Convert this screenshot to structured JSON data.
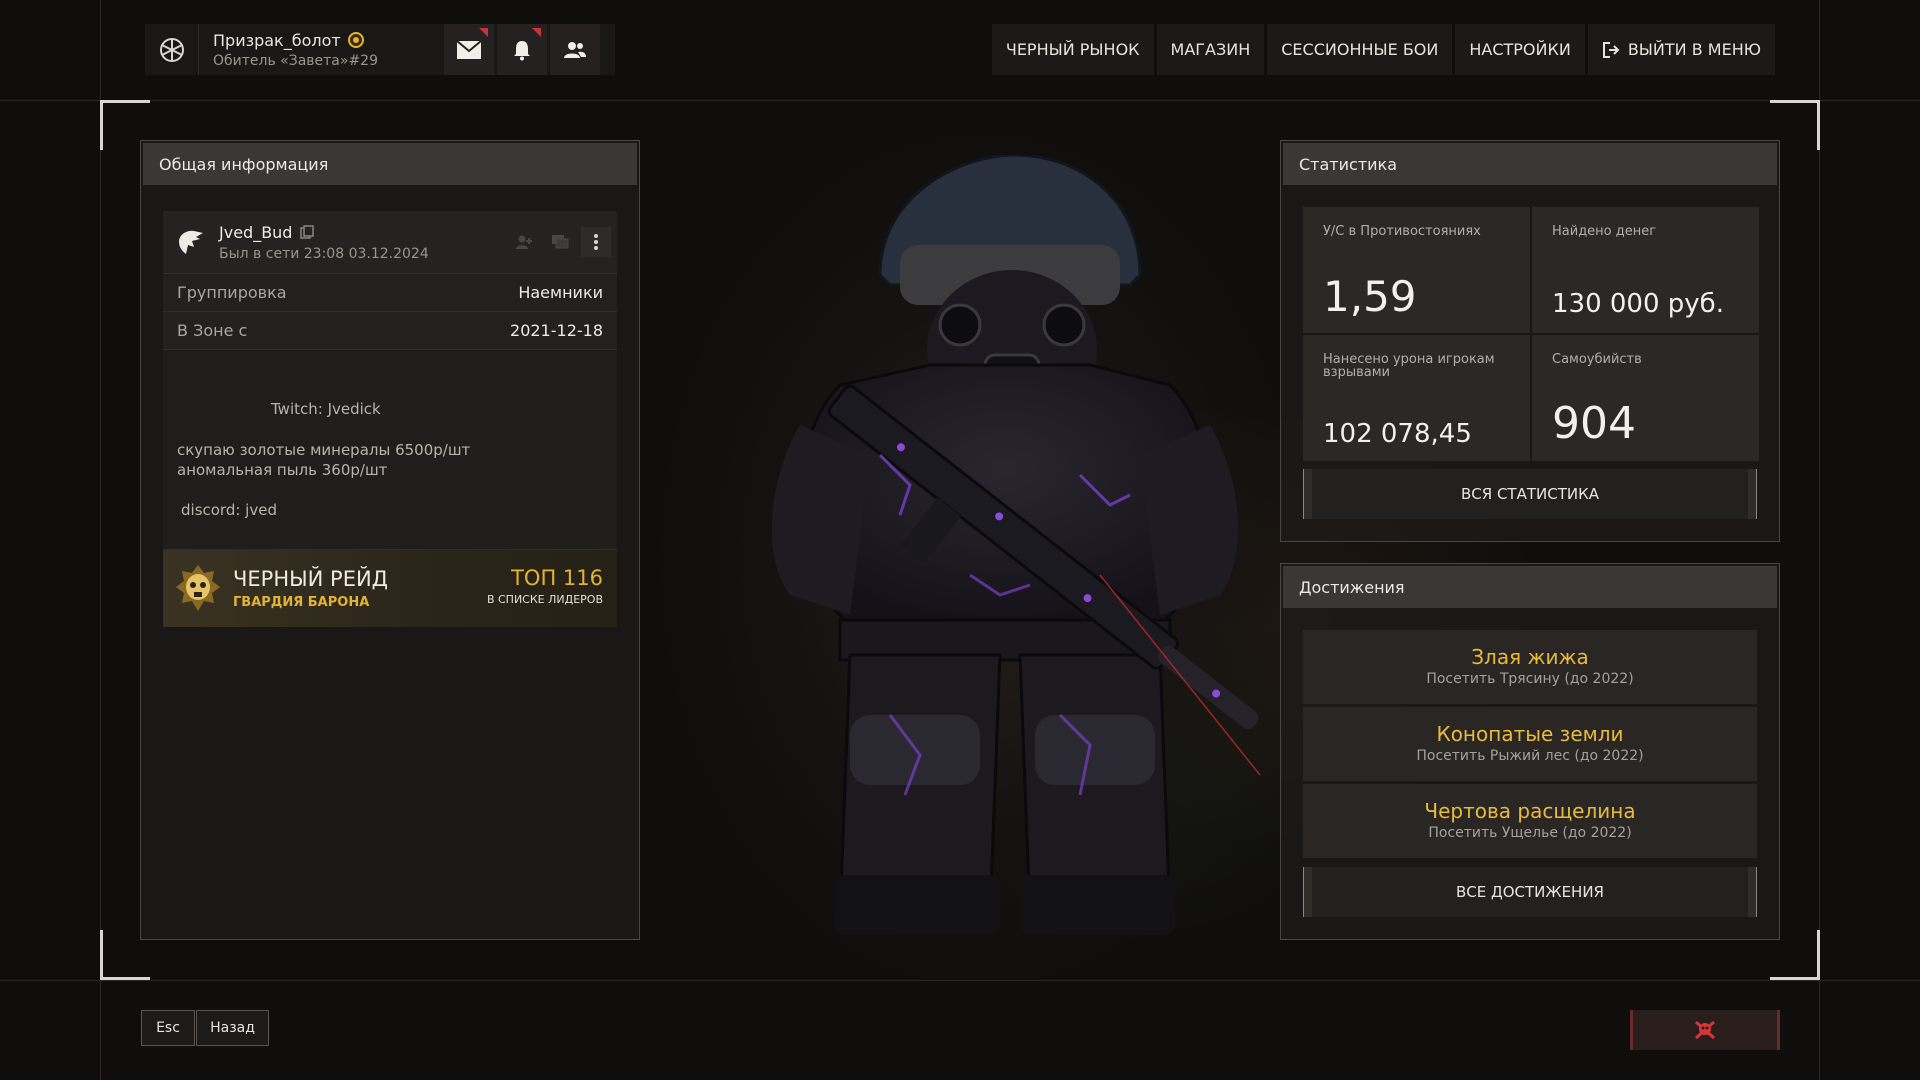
{
  "header": {
    "profile_name": "Призрак_болот",
    "profile_sub": "Обитель «Завета»#29",
    "nav": [
      "ЧЕРНЫЙ РЫНОК",
      "МАГАЗИН",
      "СЕССИОННЫЕ БОИ",
      "НАСТРОЙКИ",
      "ВЫЙТИ В МЕНЮ"
    ]
  },
  "general": {
    "title": "Общая информация",
    "username": "Jved_Bud",
    "last_seen": "Был в сети 23:08 03.12.2024",
    "rows": [
      {
        "key": "Группировка",
        "value": "Наемники"
      },
      {
        "key": "В Зоне с",
        "value": "2021-12-18"
      }
    ],
    "bio": {
      "twitch": "Twitch: Jvedick",
      "line1": "скупаю золотые минералы 6500р/шт",
      "line2": "аномальная пыль 360р/шт",
      "discord": "discord: jved"
    },
    "raid": {
      "title": "ЧЕРНЫЙ РЕЙД",
      "subtitle": "ГВАРДИЯ БАРОНА",
      "top": "ТОП 116",
      "top_sub": "В СПИСКЕ ЛИДЕРОВ"
    }
  },
  "stats": {
    "title": "Статистика",
    "cells": [
      {
        "label": "У/С в Противостояниях",
        "value": "1,59"
      },
      {
        "label": "Найдено денег",
        "value": "130 000 руб."
      },
      {
        "label": "Нанесено урона игрокам взрывами",
        "value": "102 078,45"
      },
      {
        "label": "Самоубийств",
        "value": "904"
      }
    ],
    "button": "ВСЯ СТАТИСТИКА"
  },
  "achievements": {
    "title": "Достижения",
    "items": [
      {
        "title": "Злая жижа",
        "desc": "Посетить Трясину (до 2022)"
      },
      {
        "title": "Конопатые земли",
        "desc": "Посетить Рыжий лес (до 2022)"
      },
      {
        "title": "Чертова расщелина",
        "desc": "Посетить Ущелье (до 2022)"
      }
    ],
    "button": "ВСЕ ДОСТИЖЕНИЯ"
  },
  "footer": {
    "esc": "Esc",
    "back": "Назад"
  },
  "colors": {
    "accent_gold": "#e2b335",
    "alert_red": "#c8323a"
  }
}
